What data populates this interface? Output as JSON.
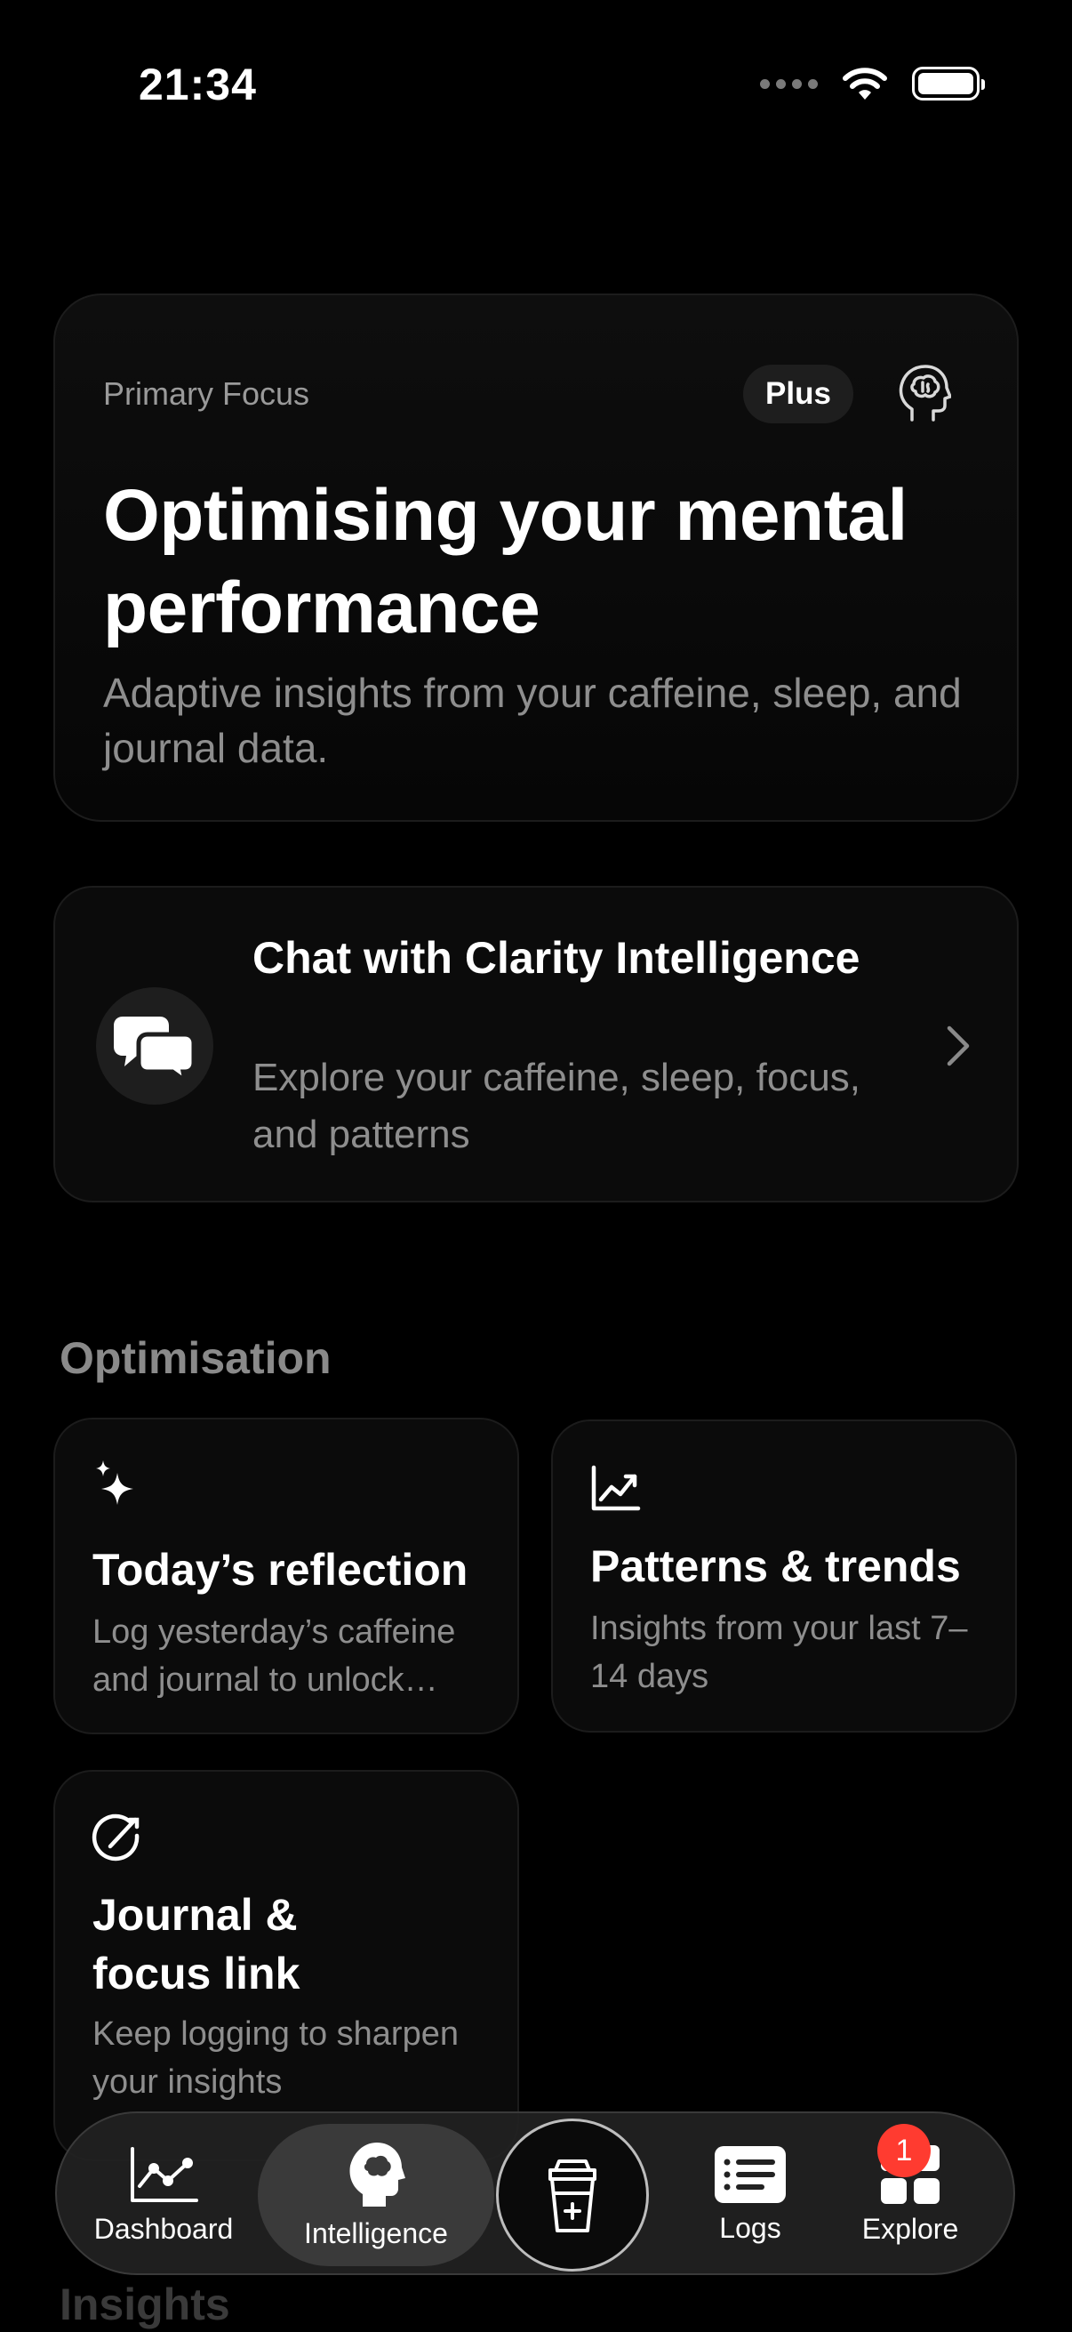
{
  "status_bar": {
    "time": "21:34"
  },
  "hero": {
    "eyebrow": "Primary Focus",
    "badge": "Plus",
    "icon": "brain-head-icon",
    "title": "Optimising your mental performance",
    "subtitle": "Adaptive insights from your caffeine, sleep, and journal data."
  },
  "chat": {
    "icon": "chat-bubbles-icon",
    "title": "Chat with Clarity Intelligence",
    "subtitle": "Explore your caffeine, sleep, focus, and patterns"
  },
  "optimisation": {
    "heading": "Optimisation",
    "tiles": [
      {
        "icon": "sparkles-icon",
        "title": "Today’s reflection",
        "subtitle": "Log yesterday’s caffeine and journal to unlock…"
      },
      {
        "icon": "trend-chart-icon",
        "title": "Patterns & trends",
        "subtitle": "Insights from your last 7–14 days"
      },
      {
        "icon": "focus-target-icon",
        "title": "Journal & focus link",
        "subtitle": "Keep logging to sharpen your insights"
      }
    ]
  },
  "insights": {
    "heading": "Insights"
  },
  "tab_bar": {
    "tabs": [
      {
        "label": "Dashboard",
        "icon": "line-chart-icon",
        "active": false
      },
      {
        "label": "Intelligence",
        "icon": "brain-head-icon",
        "active": true
      },
      {
        "label": "Logs",
        "icon": "list-icon",
        "active": false
      },
      {
        "label": "Explore",
        "icon": "grid-icon",
        "active": false
      }
    ],
    "center_icon": "coffee-cup-plus-icon",
    "explore_badge": "1"
  },
  "colors": {
    "background": "#000000",
    "card": "#0b0b0b",
    "muted_text": "#8e8e8e",
    "badge": "#ff3b30"
  }
}
